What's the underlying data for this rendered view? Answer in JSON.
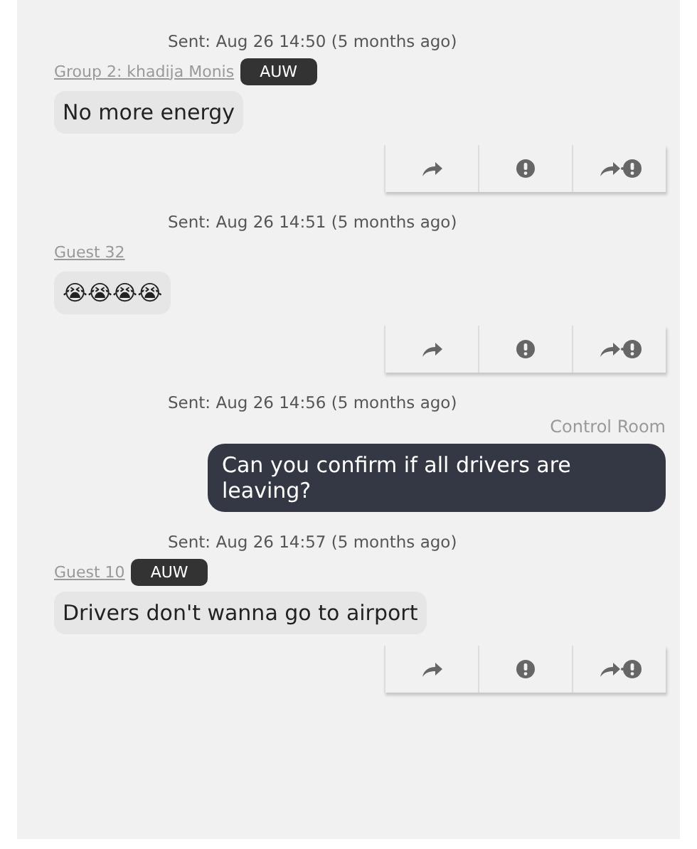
{
  "messages": [
    {
      "kind": "incoming",
      "sent": "Sent: Aug 26 14:50 (5 months ago)",
      "sender": "Group 2: khadija Monis",
      "tag": "AUW",
      "text": "No more energy"
    },
    {
      "kind": "incoming",
      "sent": "Sent: Aug 26 14:51 (5 months ago)",
      "sender": "Guest 32",
      "text": "😭😭😭😭"
    },
    {
      "kind": "outgoing",
      "sent": "Sent: Aug 26 14:56 (5 months ago)",
      "sender": "Control Room",
      "text": "Can you confirm if all drivers are leaving?"
    },
    {
      "kind": "incoming",
      "sent": "Sent: Aug 26 14:57 (5 months ago)",
      "sender": "Guest 10",
      "tag": "AUW",
      "text": "Drivers don't wanna go to airport"
    }
  ]
}
